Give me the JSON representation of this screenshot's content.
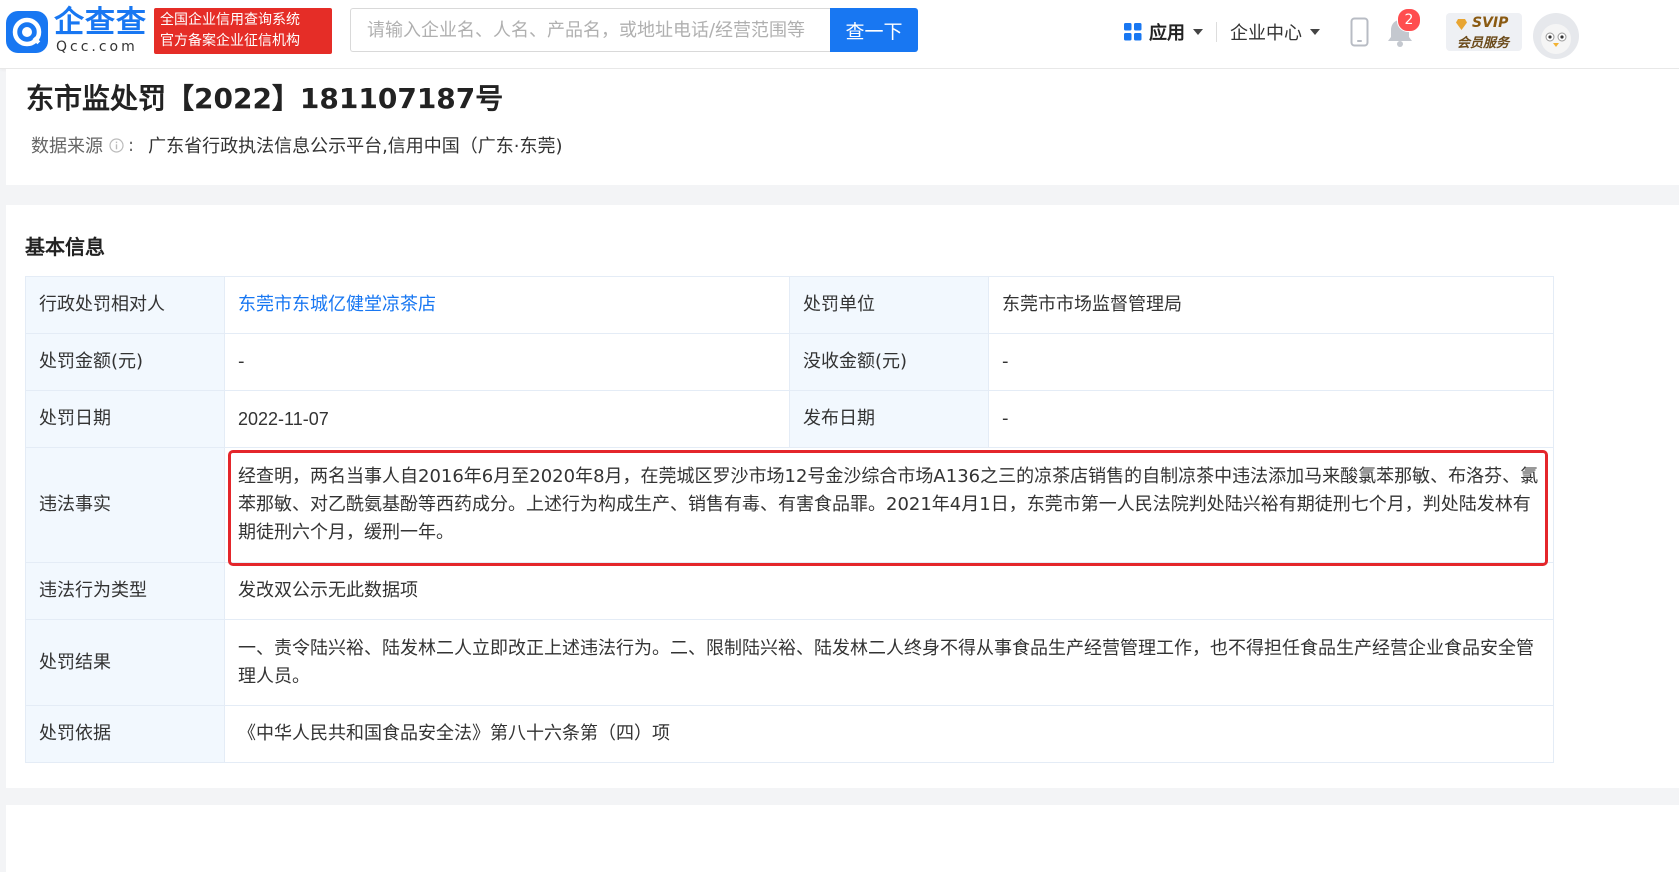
{
  "header": {
    "logo_name": "企查查",
    "logo_domain": "Qcc.com",
    "slogan_line1": "全国企业信用查询系统",
    "slogan_line2": "官方备案企业征信机构",
    "search_placeholder": "请输入企业名、人名、产品名，或地址电话/经营范围等",
    "search_button": "查一下",
    "nav_app": "应用",
    "nav_company": "企业中心",
    "notification_count": "2",
    "svip_top": "SVIP",
    "svip_bottom": "会员服务"
  },
  "decision": {
    "title": "东市监处罚【2022】181107187号",
    "source_label": "数据来源",
    "source_colon": ":",
    "source_value": "广东省行政执法信息公示平台,信用中国（广东·东莞)"
  },
  "basic_info": {
    "section_title": "基本信息",
    "party_label": "行政处罚相对人",
    "party_value": "东莞市东城亿健堂凉茶店",
    "agency_label": "处罚单位",
    "agency_value": "东莞市市场监督管理局",
    "fine_label": "处罚金额(元)",
    "fine_value": "-",
    "confiscation_label": "没收金额(元)",
    "confiscation_value": "-",
    "date_label": "处罚日期",
    "date_value": "2022-11-07",
    "publish_label": "发布日期",
    "publish_value": "-",
    "facts_label": "违法事实",
    "facts_value": "经查明，两名当事人自2016年6月至2020年8月，在莞城区罗沙市场12号金沙综合市场A136之三的凉茶店销售的自制凉茶中违法添加马来酸氯苯那敏、布洛芬、氯苯那敏、对乙酰氨基酚等西药成分。上述行为构成生产、销售有毒、有害食品罪。2021年4月1日，东莞市第一人民法院判处陆兴裕有期徒刑七个月，判处陆发林有期徒刑六个月，缓刑一年。",
    "type_label": "违法行为类型",
    "type_value": "发改双公示无此数据项",
    "result_label": "处罚结果",
    "result_value": "一、责令陆兴裕、陆发林二人立即改正上述违法行为。二、限制陆兴裕、陆发林二人终身不得从事食品生产经营管理工作，也不得担任食品生产经营企业食品安全管理人员。",
    "basis_label": "处罚依据",
    "basis_value": "《中华人民共和国食品安全法》第八十六条第（四）项"
  },
  "colors": {
    "brand_blue": "#1877f2",
    "slogan_red": "#e52d27",
    "highlight_red": "#e4262b",
    "label_bg": "#f2f8fe"
  },
  "icons": [
    "qcc-logo-icon",
    "apps-grid-icon",
    "phone-icon",
    "bell-icon",
    "diamond-icon",
    "info-circle-icon",
    "avatar-icon"
  ]
}
